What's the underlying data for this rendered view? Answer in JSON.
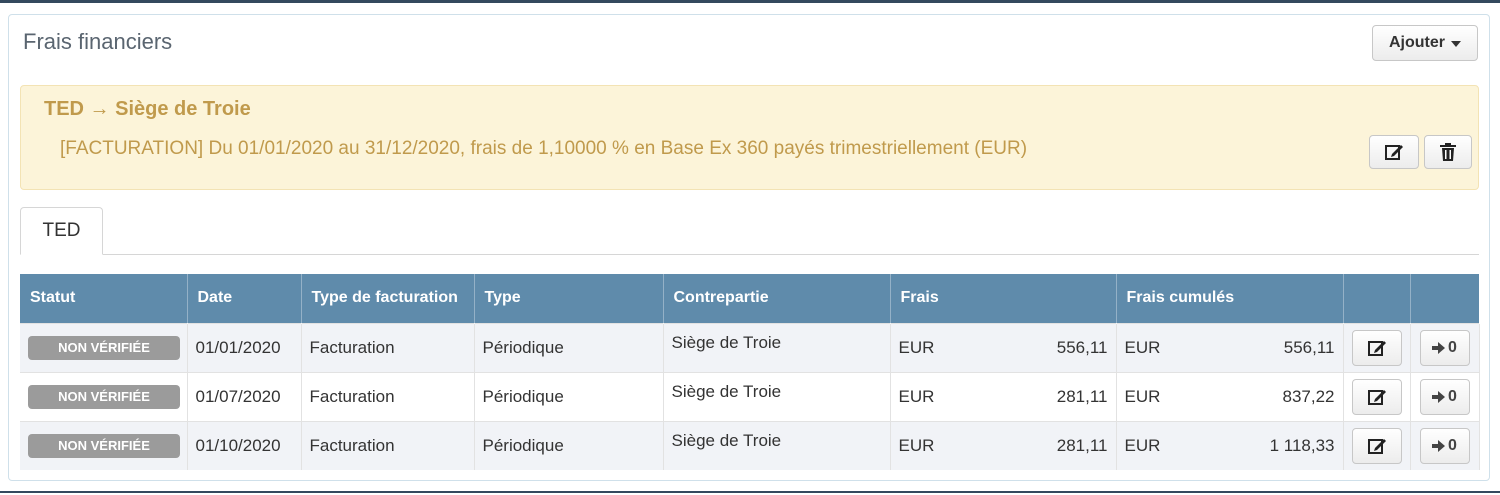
{
  "panel": {
    "title": "Frais financiers",
    "add_label": "Ajouter"
  },
  "alert": {
    "title": "TED → Siège de Troie",
    "text": "[FACTURATION] Du 01/01/2020 au 31/12/2020, frais de 1,10000 % en Base Ex 360 payés trimestriellement (EUR)"
  },
  "tabs": [
    {
      "label": "TED",
      "active": true
    }
  ],
  "table": {
    "headers": [
      "Statut",
      "Date",
      "Type de facturation",
      "Type",
      "Contrepartie",
      "Frais",
      "Frais cumulés",
      "",
      ""
    ],
    "rows": [
      {
        "status": "NON VÉRIFIÉE",
        "date": "01/01/2020",
        "billing_type": "Facturation",
        "type": "Périodique",
        "counterparty": "Siège de Troie",
        "fee_currency": "EUR",
        "fee": "556,11",
        "cum_currency": "EUR",
        "cum": "556,11",
        "action_label": "0"
      },
      {
        "status": "NON VÉRIFIÉE",
        "date": "01/07/2020",
        "billing_type": "Facturation",
        "type": "Périodique",
        "counterparty": "Siège de Troie",
        "fee_currency": "EUR",
        "fee": "281,11",
        "cum_currency": "EUR",
        "cum": "837,22",
        "action_label": "0"
      },
      {
        "status": "NON VÉRIFIÉE",
        "date": "01/10/2020",
        "billing_type": "Facturation",
        "type": "Périodique",
        "counterparty": "Siège de Troie",
        "fee_currency": "EUR",
        "fee": "281,11",
        "cum_currency": "EUR",
        "cum": "1 118,33",
        "action_label": "0"
      }
    ]
  },
  "colors": {
    "header_bg": "#5f8bab",
    "alert_bg": "#fcf4d9",
    "alert_text": "#c09a4c",
    "badge_bg": "#9b9b9b"
  },
  "icons": [
    "edit-icon",
    "trash-icon",
    "arrow-right-icon",
    "caret-down-icon"
  ]
}
